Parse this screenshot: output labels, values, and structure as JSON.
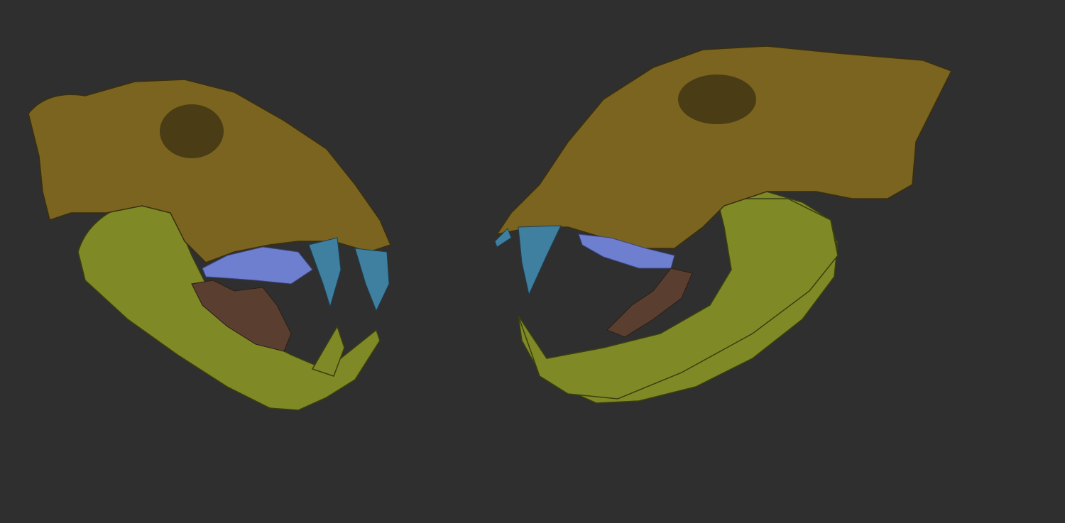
{
  "scene": {
    "background": "#2f2f2f",
    "colors": {
      "cranium": "#7a6420",
      "cranium_light": "#9a7e2c",
      "mandible": "#7f8a26",
      "canine": "#3f7fa0",
      "molars": "#6f7fd0",
      "lower_teeth": "#5a3e30",
      "shadow": "#1f1c10"
    }
  }
}
